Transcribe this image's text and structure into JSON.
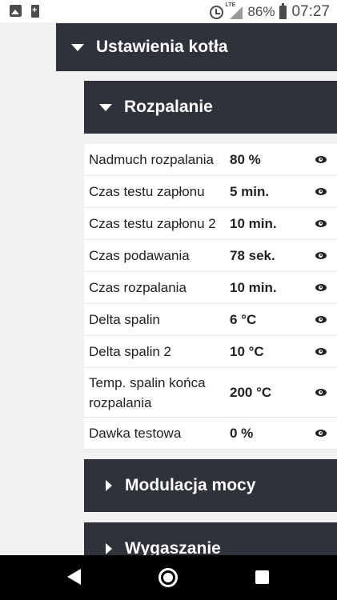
{
  "statusbar": {
    "battery_percent": "86%",
    "time": "07:27",
    "network": "LTE",
    "icons": [
      "image-icon",
      "battery-charge-icon",
      "alarm-icon",
      "signal-icon",
      "battery-icon"
    ]
  },
  "panel": {
    "title": "Ustawienia kotła"
  },
  "sections": [
    {
      "title": "Rozpalanie",
      "expanded": true
    },
    {
      "title": "Modulacja mocy",
      "expanded": false
    },
    {
      "title": "Wygaszanie",
      "expanded": false
    }
  ],
  "params": [
    {
      "label": "Nadmuch rozpalania",
      "value": "80 %"
    },
    {
      "label": "Czas testu zapłonu",
      "value": "5 min."
    },
    {
      "label": "Czas testu zapłonu 2",
      "value": "10 min."
    },
    {
      "label": "Czas podawania",
      "value": "78 sek."
    },
    {
      "label": "Czas rozpalania",
      "value": "10 min."
    },
    {
      "label": "Delta spalin",
      "value": "6 °C"
    },
    {
      "label": "Delta spalin 2",
      "value": "10 °C"
    },
    {
      "label": "Temp. spalin końca rozpalania",
      "value": "200 °C"
    },
    {
      "label": "Dawka testowa",
      "value": "0 %"
    }
  ],
  "colors": {
    "header_bg": "#2f323b",
    "page_bg": "#f1f1f1",
    "row_bg": "#ffffff"
  }
}
